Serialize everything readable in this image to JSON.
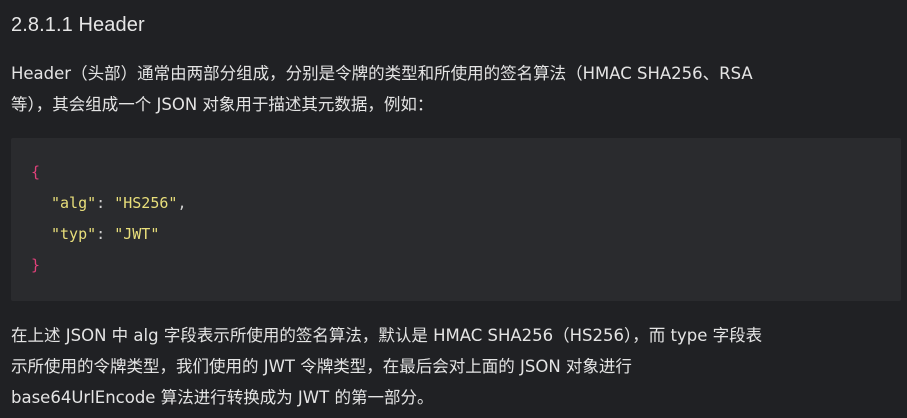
{
  "heading": "2.8.1.1 Header",
  "intro": {
    "line1": "Header（头部）通常由两部分组成，分别是令牌的类型和所使用的签名算法（HMAC SHA256、RSA",
    "line2": "等），其会组成一个 JSON 对象用于描述其元数据，例如："
  },
  "code": {
    "open_brace": "{",
    "close_brace": "}",
    "entries": [
      {
        "key": "\"alg\"",
        "colon": ": ",
        "value": "\"HS256\"",
        "trail": ","
      },
      {
        "key": "\"typ\"",
        "colon": ": ",
        "value": "\"JWT\"",
        "trail": ""
      }
    ]
  },
  "outro": {
    "line1": "在上述 JSON 中 alg 字段表示所使用的签名算法，默认是 HMAC SHA256（HS256），而 type 字段表",
    "line2": "示所使用的令牌类型，我们使用的 JWT 令牌类型，在最后会对上面的 JSON 对象进行",
    "line3": "base64UrlEncode 算法进行转换成为 JWT 的第一部分。"
  }
}
